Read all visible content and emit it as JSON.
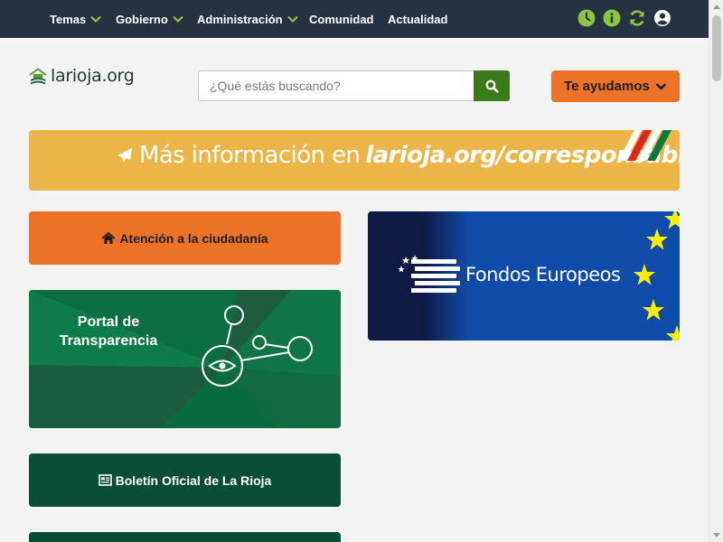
{
  "nav": {
    "items": [
      {
        "label": "Temas",
        "has_dropdown": true
      },
      {
        "label": "Gobierno",
        "has_dropdown": true
      },
      {
        "label": "Administración",
        "has_dropdown": true
      },
      {
        "label": "Comunidad",
        "has_dropdown": false
      },
      {
        "label": "Actualidad",
        "has_dropdown": false
      }
    ],
    "icons": [
      "clock-icon",
      "info-icon",
      "refresh-icon",
      "user-icon"
    ]
  },
  "header": {
    "logo_text": "larioja.org",
    "search_placeholder": "¿Qué estás buscando?",
    "help_label": "Te ayudamos"
  },
  "banner": {
    "prefix": "Más información en",
    "link": "larioja.org/corresponsables"
  },
  "cards": {
    "atencion_label": "Atención a la ciudadanía",
    "transparencia_line1": "Portal de",
    "transparencia_line2": "Transparencia",
    "fondos_label": "Fondos Europeos",
    "boletin_label": "Boletín Oficial de La Rioja"
  },
  "colors": {
    "nav_bg": "#243241",
    "accent_green": "#3a7a1a",
    "orange": "#ec7228",
    "banner_yellow": "#ecb547",
    "dark_green": "#0a4d36",
    "eu_blue": "#0f4ba8",
    "star_yellow": "#ffed00"
  }
}
